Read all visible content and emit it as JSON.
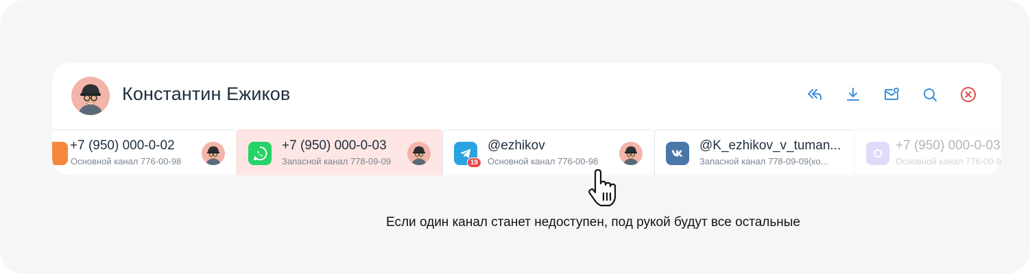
{
  "contact": {
    "name": "Константин Ежиков"
  },
  "actions": [
    {
      "name": "reply-icon"
    },
    {
      "name": "download-icon"
    },
    {
      "name": "mail-icon"
    },
    {
      "name": "search-icon"
    },
    {
      "name": "close-icon"
    }
  ],
  "colors": {
    "accent": "#3b8fd9",
    "close": "#e24a4a",
    "active_channel_bg": "#fde6e3",
    "whatsapp": "#25d366",
    "telegram": "#2aa3e0",
    "vk": "#4a76a8",
    "max": "#a39bf5",
    "orange": "#f5883c"
  },
  "channels": [
    {
      "title": "+7 (950) 000-0-02",
      "subtitle": "Основной канал 776-00-98",
      "icon": "orange-channel-icon"
    },
    {
      "title": "+7 (950) 000-0-03",
      "subtitle": "Запасной канал 778-09-09",
      "icon": "whatsapp-icon"
    },
    {
      "title": "@ezhikov",
      "subtitle": "Основной канал 776-00-98",
      "icon": "telegram-icon",
      "badge": "19"
    },
    {
      "title": "@K_ezhikov_v_tuman...",
      "subtitle": "Запасной канал 778-09-09(ко...",
      "icon": "vk-icon"
    },
    {
      "title": "+7 (950) 000-0-03",
      "subtitle": "Основной канал 776-00-98",
      "icon": "max-icon"
    }
  ],
  "caption": "Если один канал станет недоступен, под рукой будут все остальные"
}
